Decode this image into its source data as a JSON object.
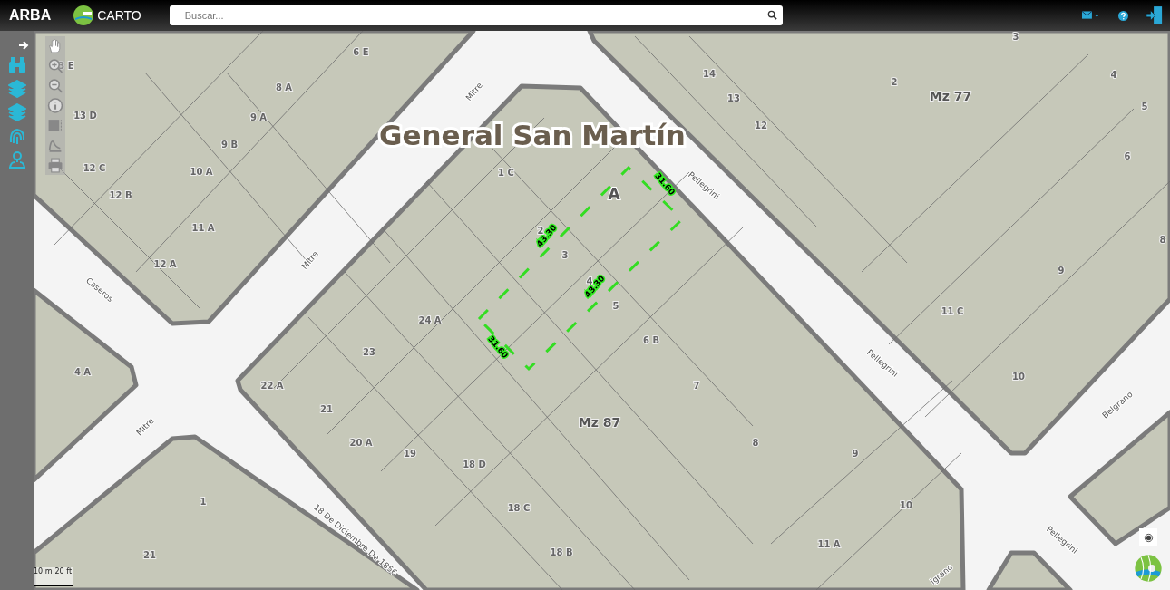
{
  "header": {
    "brand": "ARBA",
    "logo_text": "CARTO",
    "search": {
      "placeholder": "Buscar..."
    }
  },
  "map": {
    "title": "General San Martín",
    "blocks": [
      "Mz 87",
      "Mz 77"
    ],
    "parcel": {
      "label": "A",
      "measurements": [
        "31.60",
        "43.30",
        "43.30",
        "31.60"
      ]
    },
    "streets": [
      "Mitre",
      "Mitre",
      "Mitre",
      "Pellegrini",
      "Pellegrini",
      "Pellegrini",
      "Caseros",
      "Belgrano",
      "lgrano",
      "18 De Diciembre De 1856"
    ],
    "lots": [
      "3 E",
      "6 E",
      "8 A",
      "9 A",
      "13 D",
      "9 B",
      "12 C",
      "10 A",
      "12 B",
      "11 A",
      "12 A",
      "1 C",
      "2",
      "3",
      "4",
      "5",
      "24 A",
      "23",
      "6 B",
      "22 A",
      "21",
      "7",
      "20 A",
      "19",
      "18 D",
      "8",
      "9",
      "18 C",
      "10",
      "18 B",
      "11 A",
      "4 A",
      "1",
      "21",
      "3",
      "14",
      "13",
      "12",
      "2",
      "4",
      "5",
      "6",
      "9",
      "8",
      "11 C",
      "10"
    ],
    "scale": [
      "10 m",
      "20 ft"
    ]
  }
}
